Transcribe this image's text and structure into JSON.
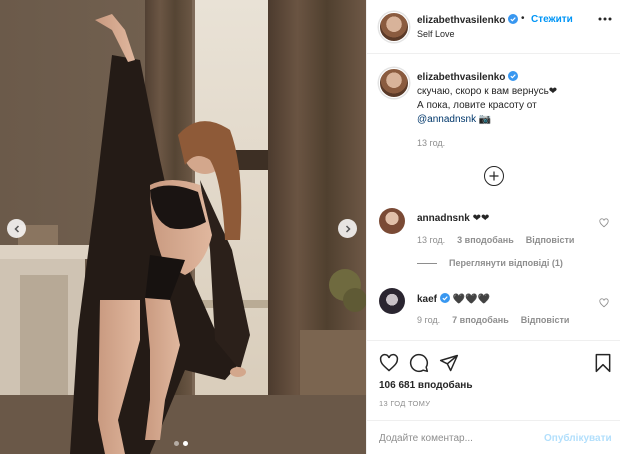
{
  "photo": {
    "description_icon": "photo-of-dancer",
    "slide_count": 2,
    "active_slide": 2
  },
  "header": {
    "username": "elizabethvasilenko",
    "separator": "•",
    "follow_label": "Стежити",
    "location": "Self Love",
    "more_icon": "more-dots-icon"
  },
  "caption": {
    "username": "elizabethvasilenko",
    "line1": "скучаю, скоро к вам вернусь❤",
    "line2": "А пока, ловите красоту от",
    "mention": "@annadnsnk",
    "trailing": " 📷",
    "time": "13 год."
  },
  "comments": [
    {
      "username": "annadnsnk",
      "text": " ❤❤",
      "time": "13 год.",
      "likes": "3 вподобань",
      "reply": "Відповісти"
    },
    {
      "username": "kaef",
      "text": " 🖤🖤🖤",
      "time": "9 год.",
      "likes": "7 вподобань",
      "reply": "Відповісти"
    }
  ],
  "view_replies": "Переглянути відповіді (1)",
  "likes_total": "106 681 вподобань",
  "posted_ago": "13 ГОД ТОМУ",
  "comment_input": {
    "placeholder": "Додайте коментар..."
  },
  "publish_label": "Опублікувати",
  "colors": {
    "accent": "#0095f6",
    "publish_disabled": "#b2dffc",
    "text": "#262626",
    "muted": "#8e8e8e"
  }
}
